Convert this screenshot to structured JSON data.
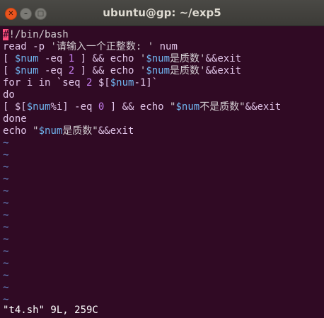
{
  "window": {
    "title": "ubuntu@gp: ~/exp5"
  },
  "editor": {
    "lines": [
      [
        {
          "t": "#",
          "c": "cursor"
        },
        {
          "t": "!/bin/bash",
          "c": "str"
        }
      ],
      [
        {
          "t": "read -p ",
          "c": "kw"
        },
        {
          "t": "'请输入一个正整数: '",
          "c": "str"
        },
        {
          "t": " num",
          "c": "kw"
        }
      ],
      [
        {
          "t": "[ ",
          "c": "kw"
        },
        {
          "t": "$num",
          "c": "var"
        },
        {
          "t": " -eq ",
          "c": "kw"
        },
        {
          "t": "1",
          "c": "num"
        },
        {
          "t": " ] && echo ",
          "c": "kw"
        },
        {
          "t": "'",
          "c": "str"
        },
        {
          "t": "$num",
          "c": "var"
        },
        {
          "t": "是质数'",
          "c": "str"
        },
        {
          "t": "&&exit",
          "c": "kw"
        }
      ],
      [
        {
          "t": "[ ",
          "c": "kw"
        },
        {
          "t": "$num",
          "c": "var"
        },
        {
          "t": " -eq ",
          "c": "kw"
        },
        {
          "t": "2",
          "c": "num"
        },
        {
          "t": " ] && echo ",
          "c": "kw"
        },
        {
          "t": "'",
          "c": "str"
        },
        {
          "t": "$num",
          "c": "var"
        },
        {
          "t": "是质数'",
          "c": "str"
        },
        {
          "t": "&&exit",
          "c": "kw"
        }
      ],
      [
        {
          "t": "for i in ",
          "c": "kw"
        },
        {
          "t": "`seq ",
          "c": "kw"
        },
        {
          "t": "2",
          "c": "num"
        },
        {
          "t": " $[",
          "c": "kw"
        },
        {
          "t": "$num",
          "c": "var"
        },
        {
          "t": "-1]`",
          "c": "kw"
        }
      ],
      [
        {
          "t": "do",
          "c": "kw"
        }
      ],
      [
        {
          "t": "[ $[",
          "c": "kw"
        },
        {
          "t": "$num",
          "c": "var"
        },
        {
          "t": "%i] -eq ",
          "c": "kw"
        },
        {
          "t": "0",
          "c": "num"
        },
        {
          "t": " ] && echo ",
          "c": "kw"
        },
        {
          "t": "\"",
          "c": "str"
        },
        {
          "t": "$num",
          "c": "var"
        },
        {
          "t": "不是质数\"",
          "c": "str"
        },
        {
          "t": "&&exit",
          "c": "kw"
        }
      ],
      [
        {
          "t": "done",
          "c": "kw"
        }
      ],
      [
        {
          "t": "echo ",
          "c": "kw"
        },
        {
          "t": "\"",
          "c": "str"
        },
        {
          "t": "$num",
          "c": "var"
        },
        {
          "t": "是质数\"",
          "c": "str"
        },
        {
          "t": "&&exit",
          "c": "kw"
        }
      ]
    ],
    "tilde_glyph": "~"
  },
  "status": {
    "text": "\"t4.sh\" 9L, 259C"
  },
  "colors": {
    "background": "#300a24",
    "keyword": "#e0c4e8",
    "variable": "#6fb3ee",
    "number": "#c67ef0",
    "tilde": "#6a8cce",
    "cursor": "#ff4d7e"
  },
  "icons": {
    "close": "close-icon",
    "minimize": "minimize-icon",
    "maximize": "maximize-icon"
  }
}
